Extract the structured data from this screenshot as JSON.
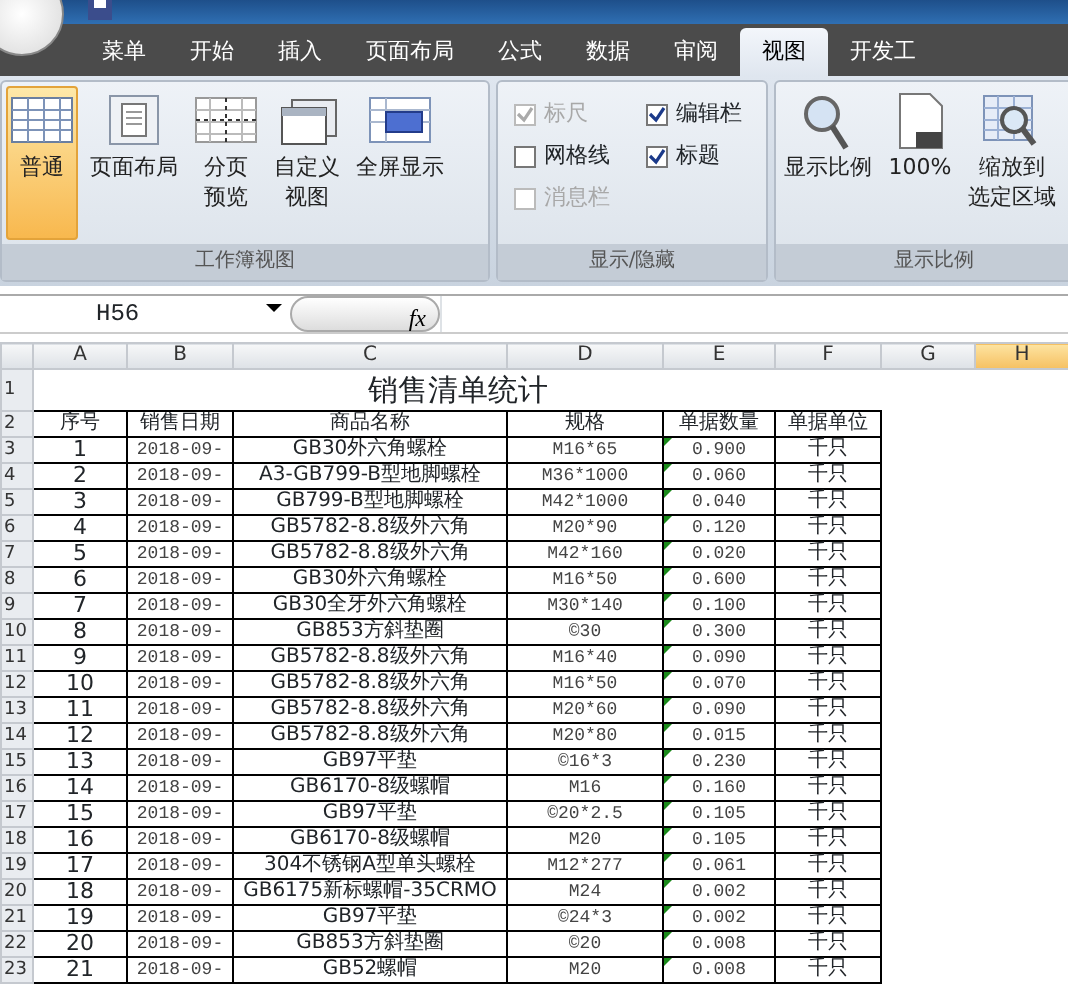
{
  "tabs": [
    {
      "label": "菜单",
      "selected": false
    },
    {
      "label": "开始",
      "selected": false
    },
    {
      "label": "插入",
      "selected": false
    },
    {
      "label": "页面布局",
      "selected": false
    },
    {
      "label": "公式",
      "selected": false
    },
    {
      "label": "数据",
      "selected": false
    },
    {
      "label": "审阅",
      "selected": false
    },
    {
      "label": "视图",
      "selected": true
    },
    {
      "label": "开发工",
      "selected": false
    }
  ],
  "ribbon": {
    "groups": [
      {
        "title": "工作簿视图",
        "kind": "buttons",
        "items": [
          {
            "lines": [
              "普通"
            ],
            "selected": true
          },
          {
            "lines": [
              "页面布局"
            ],
            "selected": false
          },
          {
            "lines": [
              "分页",
              "预览"
            ],
            "selected": false
          },
          {
            "lines": [
              "自定义",
              "视图"
            ],
            "selected": false
          },
          {
            "lines": [
              "全屏显示"
            ],
            "selected": false
          }
        ]
      },
      {
        "title": "显示/隐藏",
        "kind": "checks",
        "items": [
          {
            "label": "标尺",
            "checked": true,
            "disabled": true
          },
          {
            "label": "网格线",
            "checked": false,
            "disabled": false
          },
          {
            "label": "消息栏",
            "checked": false,
            "disabled": true
          },
          {
            "label": "编辑栏",
            "checked": true,
            "disabled": false
          },
          {
            "label": "标题",
            "checked": true,
            "disabled": false
          }
        ]
      },
      {
        "title": "显示比例",
        "kind": "buttons",
        "items": [
          {
            "lines": [
              "显示比例"
            ],
            "selected": false
          },
          {
            "lines": [
              "100%"
            ],
            "selected": false
          },
          {
            "lines": [
              "缩放到",
              "选定区域"
            ],
            "selected": false
          }
        ]
      }
    ]
  },
  "name_box": "H56",
  "formula_button": "fx",
  "columns": [
    {
      "label": "A",
      "selected": false
    },
    {
      "label": "B",
      "selected": false
    },
    {
      "label": "C",
      "selected": false
    },
    {
      "label": "D",
      "selected": false
    },
    {
      "label": "E",
      "selected": false
    },
    {
      "label": "F",
      "selected": false
    },
    {
      "label": "G",
      "selected": false
    },
    {
      "label": "H",
      "selected": true
    }
  ],
  "row_numbers": [
    "1",
    "2",
    "3",
    "4",
    "5",
    "6",
    "7",
    "8",
    "9",
    "10",
    "11",
    "12",
    "13",
    "14",
    "15",
    "16",
    "17",
    "18",
    "19",
    "20",
    "21",
    "22",
    "23"
  ],
  "sheet": {
    "title": "销售清单统计",
    "headers": [
      "序号",
      "销售日期",
      "商品名称",
      "规格",
      "单据数量",
      "单据单位"
    ],
    "rows": [
      {
        "cells": [
          "1",
          "2018-09-",
          "GB30外六角螺栓",
          "M16*65",
          "0.900",
          "千只"
        ],
        "warning": true
      },
      {
        "cells": [
          "2",
          "2018-09-",
          "A3-GB799-B型地脚螺栓",
          "M36*1000",
          "0.060",
          "千只"
        ],
        "warning": true
      },
      {
        "cells": [
          "3",
          "2018-09-",
          "GB799-B型地脚螺栓",
          "M42*1000",
          "0.040",
          "千只"
        ],
        "warning": true
      },
      {
        "cells": [
          "4",
          "2018-09-",
          "GB5782-8.8级外六角",
          "M20*90",
          "0.120",
          "千只"
        ],
        "warning": true
      },
      {
        "cells": [
          "5",
          "2018-09-",
          "GB5782-8.8级外六角",
          "M42*160",
          "0.020",
          "千只"
        ],
        "warning": true
      },
      {
        "cells": [
          "6",
          "2018-09-",
          "GB30外六角螺栓",
          "M16*50",
          "0.600",
          "千只"
        ],
        "warning": true
      },
      {
        "cells": [
          "7",
          "2018-09-",
          "GB30全牙外六角螺栓",
          "M30*140",
          "0.100",
          "千只"
        ],
        "warning": true
      },
      {
        "cells": [
          "8",
          "2018-09-",
          "GB853方斜垫圈",
          "©30",
          "0.300",
          "千只"
        ],
        "warning": true
      },
      {
        "cells": [
          "9",
          "2018-09-",
          "GB5782-8.8级外六角",
          "M16*40",
          "0.090",
          "千只"
        ],
        "warning": true
      },
      {
        "cells": [
          "10",
          "2018-09-",
          "GB5782-8.8级外六角",
          "M16*50",
          "0.070",
          "千只"
        ],
        "warning": true
      },
      {
        "cells": [
          "11",
          "2018-09-",
          "GB5782-8.8级外六角",
          "M20*60",
          "0.090",
          "千只"
        ],
        "warning": true
      },
      {
        "cells": [
          "12",
          "2018-09-",
          "GB5782-8.8级外六角",
          "M20*80",
          "0.015",
          "千只"
        ],
        "warning": true
      },
      {
        "cells": [
          "13",
          "2018-09-",
          "GB97平垫",
          "©16*3",
          "0.230",
          "千只"
        ],
        "warning": true
      },
      {
        "cells": [
          "14",
          "2018-09-",
          "GB6170-8级螺帽",
          "M16",
          "0.160",
          "千只"
        ],
        "warning": true
      },
      {
        "cells": [
          "15",
          "2018-09-",
          "GB97平垫",
          "©20*2.5",
          "0.105",
          "千只"
        ],
        "warning": true
      },
      {
        "cells": [
          "16",
          "2018-09-",
          "GB6170-8级螺帽",
          "M20",
          "0.105",
          "千只"
        ],
        "warning": true
      },
      {
        "cells": [
          "17",
          "2018-09-",
          "304不锈钢A型单头螺栓",
          "M12*277",
          "0.061",
          "千只"
        ],
        "warning": true
      },
      {
        "cells": [
          "18",
          "2018-09-",
          "GB6175新标螺帽-35CRMO",
          "M24",
          "0.002",
          "千只"
        ],
        "warning": true
      },
      {
        "cells": [
          "19",
          "2018-09-",
          "GB97平垫",
          "©24*3",
          "0.002",
          "千只"
        ],
        "warning": true
      },
      {
        "cells": [
          "20",
          "2018-09-",
          "GB853方斜垫圈",
          "©20",
          "0.008",
          "千只"
        ],
        "warning": true
      },
      {
        "cells": [
          "21",
          "2018-09-",
          "GB52螺帽",
          "M20",
          "0.008",
          "千只"
        ],
        "warning": true
      }
    ]
  }
}
